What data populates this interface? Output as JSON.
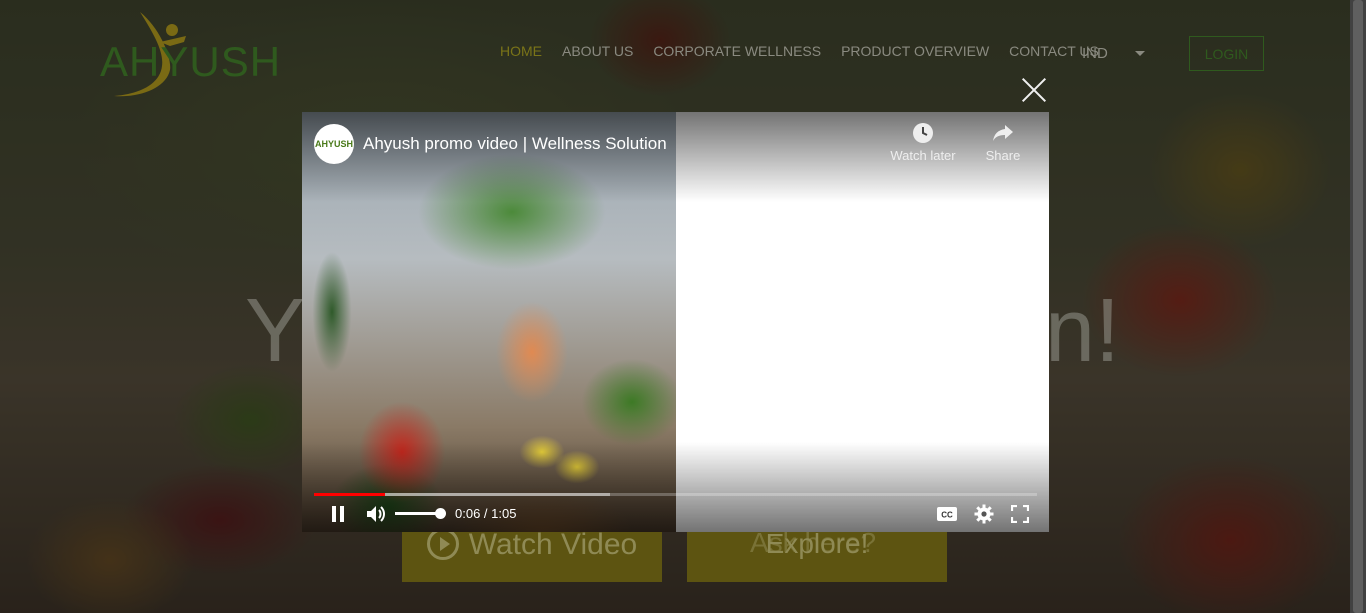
{
  "site": {
    "logo_text": "AHYUSH",
    "nav": [
      {
        "label": "HOME",
        "active": true
      },
      {
        "label": "ABOUT US",
        "active": false
      },
      {
        "label": "CORPORATE WELLNESS",
        "active": false
      },
      {
        "label": "PRODUCT OVERVIEW",
        "active": false
      },
      {
        "label": "CONTACT US",
        "active": false
      }
    ],
    "language": "IND",
    "login_label": "LOGIN"
  },
  "hero": {
    "headline_left": "Y",
    "headline_right": "n!",
    "watch_video_label": "Watch Video",
    "explore_label": "Explore!",
    "explore_ghost": "Ask here?"
  },
  "player": {
    "channel_avatar_text": "AHYUSH",
    "title": "Ahyush promo video | Wellness Solution",
    "watch_later_label": "Watch later",
    "share_label": "Share",
    "current_time": "0:06",
    "duration": "1:05",
    "time_display": "0:06 / 1:05",
    "progress_played_fraction": 0.098,
    "progress_buffered_fraction": 0.41,
    "volume_fraction": 1.0
  },
  "colors": {
    "accent_active_nav": "#7a7418",
    "brand_green": "#2f5a1e",
    "progress_red": "#ff0000",
    "button_gold": "#5d5411"
  }
}
